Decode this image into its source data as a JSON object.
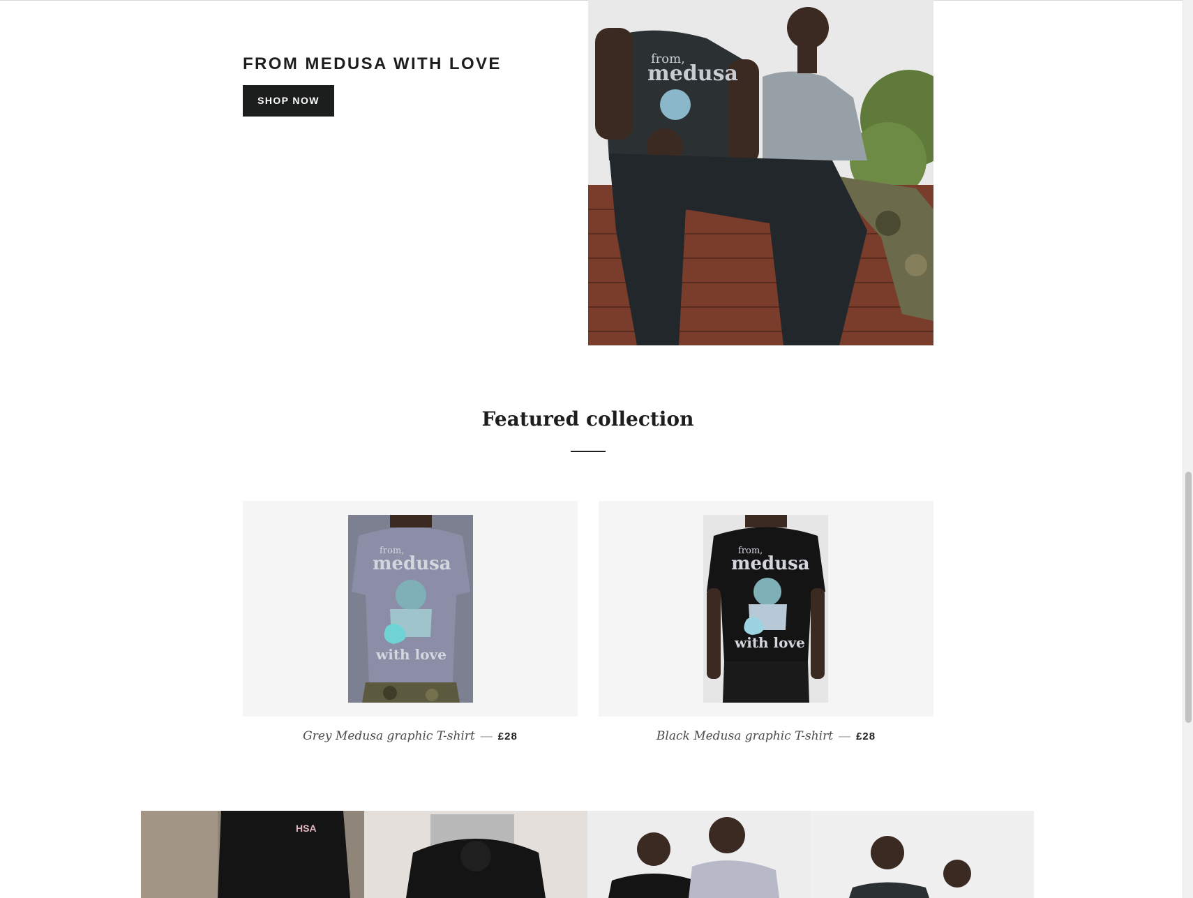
{
  "hero": {
    "title": "FROM MEDUSA WITH LOVE",
    "button_label": "SHOP NOW"
  },
  "featured": {
    "heading": "Featured collection",
    "products": [
      {
        "name": "Grey Medusa graphic T-shirt",
        "separator": "—",
        "price": "£28"
      },
      {
        "name": "Black Medusa graphic T-shirt",
        "separator": "—",
        "price": "£28"
      }
    ]
  },
  "shirt_print": {
    "line1": "from,",
    "line2": "medusa",
    "line3": "with love"
  },
  "strip_print": {
    "hoodie_logo": "HSA"
  },
  "colors": {
    "primary": "#1c1d1d",
    "background": "#ffffff",
    "card_bg": "#f5f5f5"
  }
}
